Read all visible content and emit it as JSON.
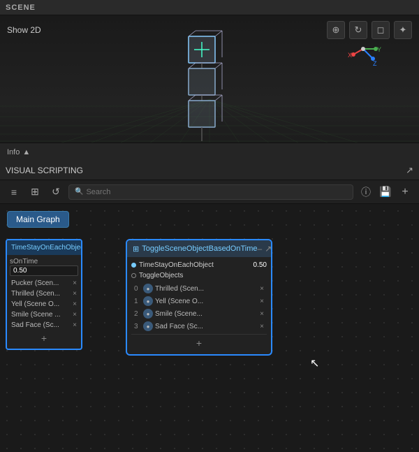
{
  "scene": {
    "header": "SCENE",
    "show2d_label": "Show 2D",
    "info_label": "Info",
    "toolbar": {
      "move_label": "⊕",
      "rotate_label": "↻",
      "scale_label": "□",
      "multi_label": "✦"
    },
    "cubes": [
      {
        "id": "cube-top",
        "active": true
      },
      {
        "id": "cube-mid",
        "active": false
      },
      {
        "id": "cube-bot",
        "active": false
      }
    ]
  },
  "vs": {
    "header": "VISUAL SCRIPTING",
    "search_placeholder": "Search",
    "main_graph_label": "Main Graph",
    "left_node": {
      "title": "TimeStayOnEachObject",
      "field_label": "sOnTime",
      "field_value": "0.50",
      "items": [
        {
          "name": "Pucker (Scen...",
          "id": 0
        },
        {
          "name": "Thrilled (Scen...",
          "id": 1
        },
        {
          "name": "Yell (Scene O...",
          "id": 2
        },
        {
          "name": "Smile (Scene ...",
          "id": 3
        },
        {
          "name": "Sad Face (Sc...",
          "id": 4
        }
      ]
    },
    "main_node": {
      "title": "ToggleSceneObjectBasedOnTime",
      "row1_label": "TimeStayOnEachObject",
      "row1_value": "0.50",
      "row2_label": "ToggleObjects",
      "toggle_items": [
        {
          "num": "0",
          "name": "Thrilled (Scen..."
        },
        {
          "num": "1",
          "name": "Yell (Scene O..."
        },
        {
          "num": "2",
          "name": "Smile (Scene..."
        },
        {
          "num": "3",
          "name": "Sad Face (Sc..."
        }
      ]
    }
  },
  "icons": {
    "hamburger": "≡",
    "grid": "⊞",
    "refresh": "↺",
    "search": "🔍",
    "info_circle": "ⓘ",
    "save": "💾",
    "add": "+",
    "expand_arrow": "↗",
    "camera": "📹",
    "caret_up": "▲",
    "x_close": "×",
    "grid_icon": "⊞",
    "dot_icon": "●"
  },
  "colors": {
    "accent_blue": "#2a8aff",
    "header_bg": "#252525",
    "node_bg": "#222222",
    "viewport_bg": "#1c1c1c",
    "dot_grid": "#333333",
    "cyan": "#7ac8f0"
  }
}
